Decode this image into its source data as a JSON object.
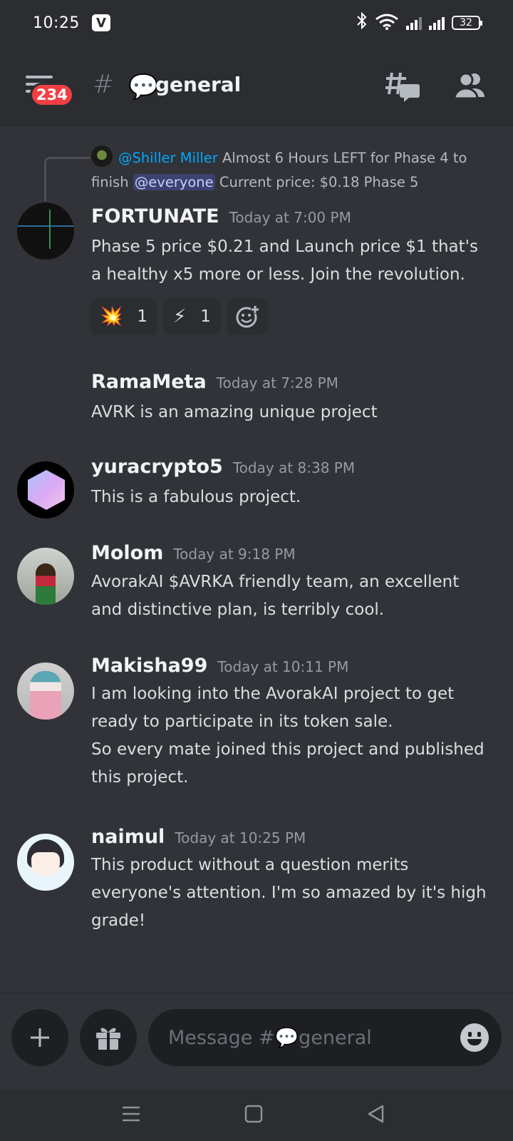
{
  "status_bar": {
    "time": "10:25",
    "app_badge": "V",
    "battery": "32"
  },
  "header": {
    "notification_count": "234",
    "channel_emoji": "💬",
    "channel_name": "general"
  },
  "reply": {
    "mention": "@Shiller Miller",
    "text_before": " Almost 6 Hours LEFT for Phase 4 to finish ",
    "everyone": "@everyone",
    "text_after": "  Current price: $0.18 Phase 5"
  },
  "messages": [
    {
      "username": "FORTUNATE",
      "timestamp": "Today at 7:00 PM",
      "body": "Phase 5 price $0.21 and Launch price $1 that's a healthy x5 more or less. Join the revolution.",
      "reactions": [
        {
          "emoji": "💥",
          "count": "1"
        },
        {
          "emoji": "⚡",
          "count": "1"
        }
      ]
    },
    {
      "username": "RamaMeta",
      "timestamp": "Today at 7:28 PM",
      "body": "AVRK is an amazing unique project"
    },
    {
      "username": "yuracrypto5",
      "timestamp": "Today at 8:38 PM",
      "body": "This is a fabulous project."
    },
    {
      "username": "Molom",
      "timestamp": "Today at 9:18 PM",
      "body": "AvorakAI $AVRKA friendly team, an excellent and distinctive plan, is terribly cool."
    },
    {
      "username": "Makisha99",
      "timestamp": "Today at 10:11 PM",
      "body_lines": [
        "I am looking into the AvorakAI project to get ready to participate in its token sale.",
        "So every mate joined this project and published this project."
      ]
    },
    {
      "username": "naimul",
      "timestamp": "Today at 10:25 PM",
      "body": "This product without a question merits everyone's attention. I'm so amazed by it's high grade!"
    }
  ],
  "composer": {
    "placeholder": "Message #💬general"
  },
  "colors": {
    "background": "#313338",
    "header": "#2b2d31",
    "mention": "#00a8fc",
    "badge": "#f23f43"
  }
}
